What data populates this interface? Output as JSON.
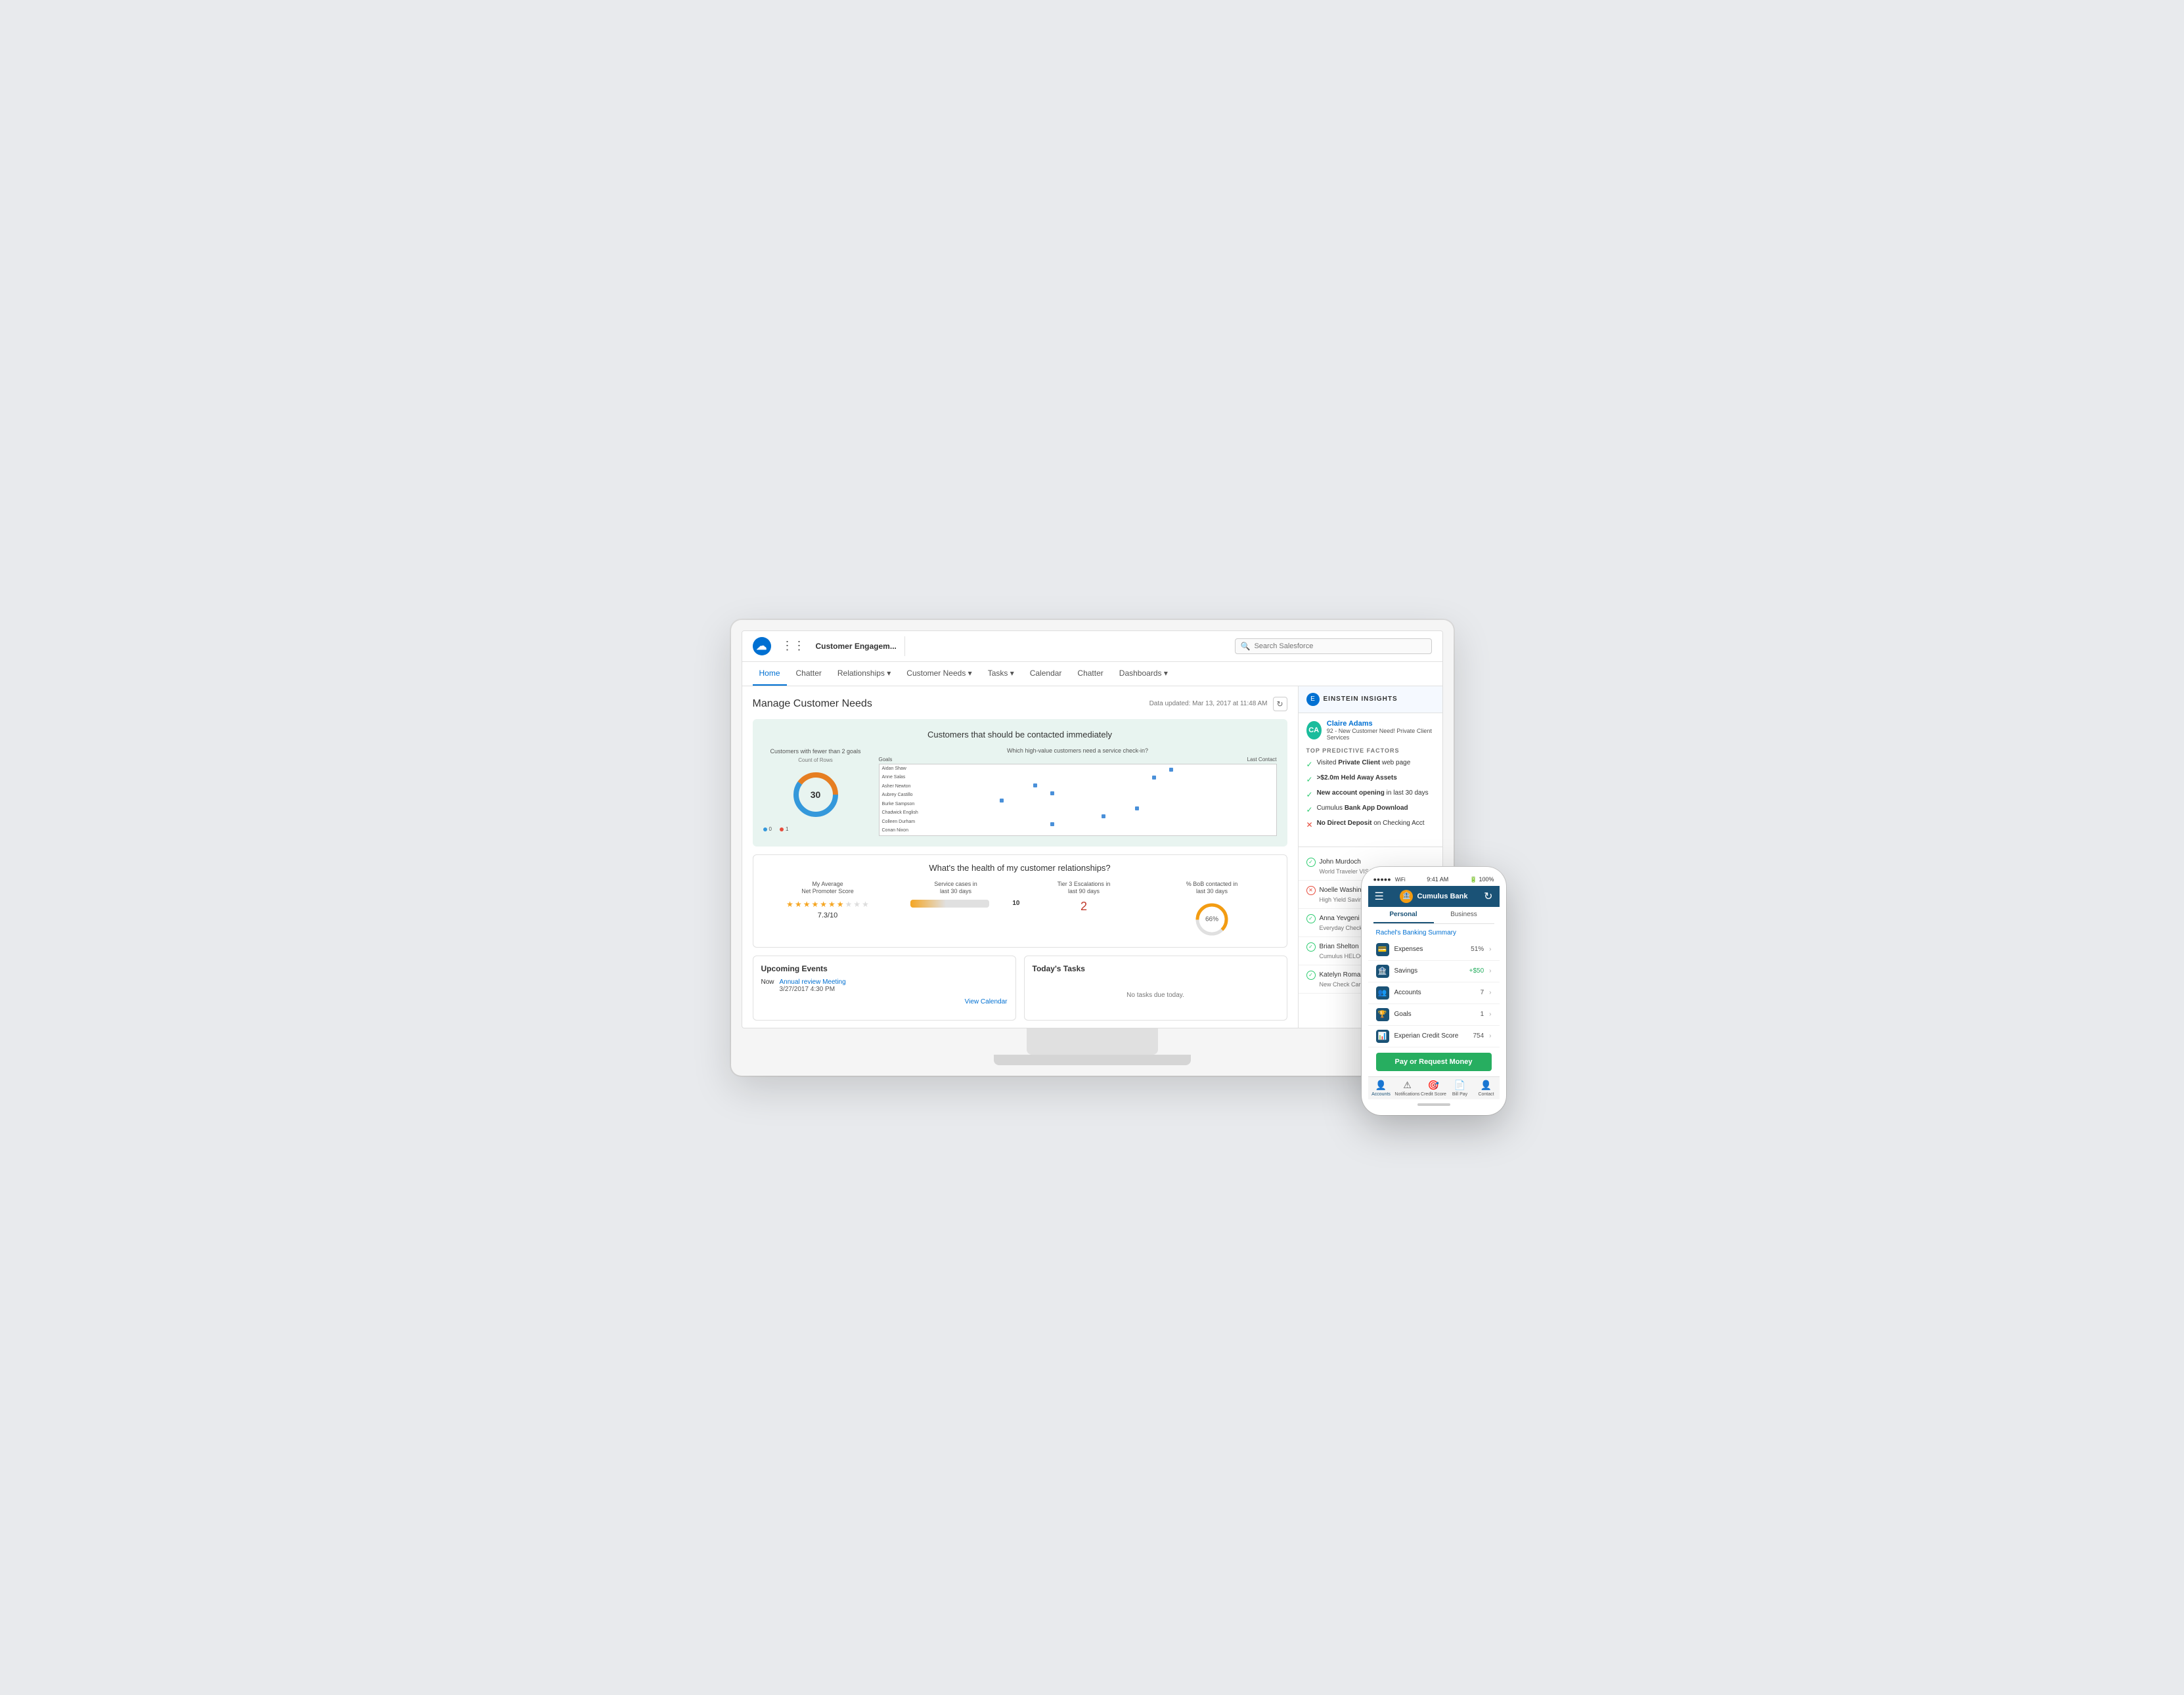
{
  "app": {
    "logo": "☁",
    "name": "Customer Engagem...",
    "search_placeholder": "Search Salesforce"
  },
  "nav": {
    "items": [
      {
        "label": "Home",
        "active": true
      },
      {
        "label": "Chatter",
        "active": false
      },
      {
        "label": "Relationships",
        "active": false,
        "dropdown": true
      },
      {
        "label": "Customer Needs",
        "active": false,
        "dropdown": true
      },
      {
        "label": "Tasks",
        "active": false,
        "dropdown": true
      },
      {
        "label": "Calendar",
        "active": false
      },
      {
        "label": "Chatter",
        "active": false
      },
      {
        "label": "Dashboards",
        "active": false,
        "dropdown": true
      }
    ]
  },
  "main": {
    "title": "Manage Customer Needs",
    "data_updated": "Data updated: Mar 13, 2017 at 11:48 AM"
  },
  "chart": {
    "title": "Customers that should be contacted immediately",
    "donut": {
      "label": "Customers with fewer than 2 goals",
      "sublabel": "Count of Rows",
      "value": "30"
    },
    "scatter": {
      "title": "Which high-value customers need a service check-in?",
      "x_label": "Last Contact",
      "y_label": "Goals",
      "legend": [
        {
          "label": "0",
          "color": "#4a90d9"
        },
        {
          "label": "1",
          "color": "#e74c3c"
        }
      ],
      "names": [
        "Aidan Shaw",
        "Anne Salas",
        "Asher Newton",
        "Aubrey Castillo",
        "Burke Sampson",
        "Chadwick English",
        "Colleen Durham",
        "Conan Nixon"
      ]
    }
  },
  "health": {
    "title": "What's the health of my customer relationships?",
    "metrics": [
      {
        "label": "My Average Net Promoter Score",
        "type": "stars",
        "value": "7.3/10"
      },
      {
        "label": "Service cases in last 30 days",
        "type": "progress",
        "value": "10"
      },
      {
        "label": "Tier 3 Escalations in last 90 days",
        "type": "number",
        "value": "2"
      },
      {
        "label": "% BoB contacted in last 30 days",
        "type": "gauge",
        "value": "66%"
      }
    ]
  },
  "events": {
    "title": "Upcoming Events",
    "items": [
      {
        "time": "Now",
        "name": "Annual review Meeting",
        "date": "3/27/2017 4:30 PM"
      }
    ],
    "view_calendar": "View Calendar"
  },
  "tasks": {
    "title": "Today's Tasks",
    "empty": "No tasks due today."
  },
  "einstein": {
    "title": "EINSTEIN INSIGHTS",
    "person": {
      "name": "Claire Adams",
      "subtitle": "92 - New Customer Need! Private Client Services"
    },
    "predictive_title": "TOP PREDICTIVE FACTORS",
    "factors": [
      {
        "text": "Visited Private Client web page",
        "type": "green"
      },
      {
        "text": ">$2.0m Held Away Assets",
        "type": "green"
      },
      {
        "text": "New account opening in last 30 days",
        "type": "green"
      },
      {
        "text": "Cumulus Bank App Download",
        "type": "green"
      },
      {
        "text": "No Direct Deposit on Checking Acct",
        "type": "red"
      }
    ]
  },
  "contacts": [
    {
      "name": "John Murdoch",
      "detail": "World Traveler VISA - Custo...",
      "status": "green"
    },
    {
      "name": "Noelle Washington",
      "detail": "High Yield Savings - Custom...",
      "status": "orange"
    },
    {
      "name": "Anna Yevgeni",
      "detail": "Everyday Checking - No ac...",
      "status": "green"
    },
    {
      "name": "Brian Shelton",
      "detail": "Cumulus HELOC - Specialty...",
      "status": "green"
    },
    {
      "name": "Katelyn Roman",
      "detail": "New Check Card - Initial tr...",
      "status": "green"
    }
  ],
  "phone": {
    "status_time": "9:41 AM",
    "battery": "100%",
    "bank_name": "Cumulus Bank",
    "tabs": [
      "Personal",
      "Business"
    ],
    "active_tab": "Personal",
    "summary_title": "Rachel's Banking Summary",
    "metrics": [
      {
        "icon": "💳",
        "label": "Expenses",
        "value": "51%",
        "color": "normal"
      },
      {
        "icon": "🏦",
        "label": "Savings",
        "value": "+$50",
        "color": "green"
      },
      {
        "icon": "👥",
        "label": "Accounts",
        "value": "7",
        "color": "normal"
      },
      {
        "icon": "🏆",
        "label": "Goals",
        "value": "1",
        "color": "normal"
      },
      {
        "icon": "📊",
        "label": "Experian Credit Score",
        "value": "754",
        "color": "normal"
      }
    ],
    "cta_label": "Pay or Request Money",
    "bottom_nav": [
      "Accounts",
      "Notifications",
      "Credit Score",
      "Bill Pay",
      "Contact"
    ]
  }
}
